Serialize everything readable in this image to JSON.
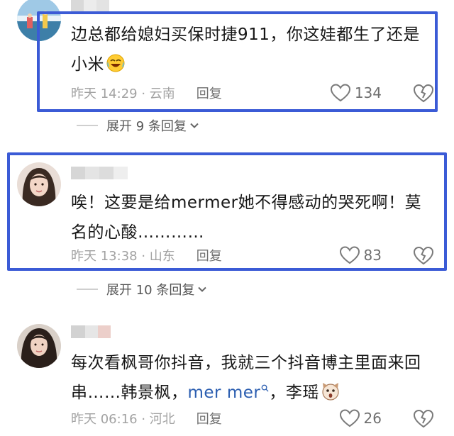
{
  "comments": [
    {
      "text_line1": "边总都给媳妇买保时捷911，你这娃都生了还是",
      "text_line2": "小米",
      "emoji_icon": "laughing-tears-emoji",
      "time_location": "昨天 14:29 · 云南",
      "reply_label": "回复",
      "like_count": "134",
      "expand_label": "展开 9 条回复"
    },
    {
      "text_line1": "唉！这要是给mermer她不得感动的哭死啊！莫",
      "text_line2": "名的心酸…………",
      "time_location": "昨天 13:38 · 山东",
      "reply_label": "回复",
      "like_count": "83",
      "expand_label": "展开 10 条回复"
    },
    {
      "text_line1": "每次看枫哥你抖音，我就三个抖音博主里面来回",
      "text_line2_a": "串……韩景枫，",
      "text_line2_link": "mer mer",
      "text_line2_b": "，李瑶",
      "emoji_icon": "surprised-dog-emoji",
      "time_location": "昨天 06:16 · 河北",
      "reply_label": "回复",
      "like_count": "26"
    }
  ],
  "colors": {
    "highlight_border": "#3b5bd6",
    "link": "#2a5db0",
    "meta_text": "#a2a2a2"
  }
}
